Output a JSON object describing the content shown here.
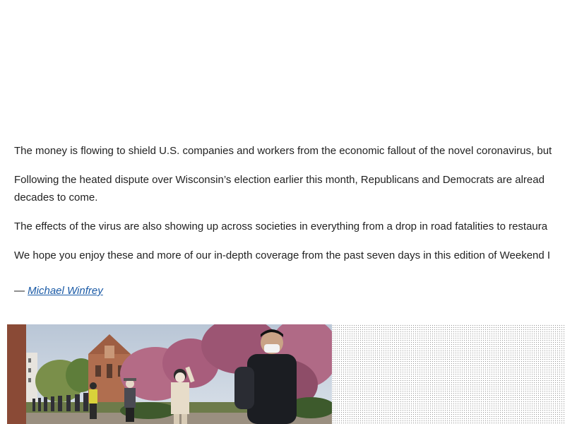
{
  "article": {
    "paragraphs": [
      {
        "lines": [
          "The money is flowing to shield U.S. companies and workers from the economic fallout of the novel coronavirus, but"
        ]
      },
      {
        "lines": [
          "Following the heated dispute over Wisconsin’s election earlier this month, Republicans and Democrats are alread",
          "decades to come."
        ]
      },
      {
        "lines": [
          "The effects of the virus are also showing up across societies in everything from a drop in road fatalities to restaura"
        ]
      },
      {
        "lines": [
          "We hope you enjoy these and more of our in-depth coverage from the past seven days in this edition of Weekend I"
        ]
      }
    ],
    "signoff": {
      "dash": "— ",
      "author": "Michael Winfrey"
    }
  },
  "photo": {
    "subject": "people in masks queuing outdoors near a church with blossoming trees"
  },
  "colors": {
    "text": "#222222",
    "link": "#1a5aa6"
  }
}
